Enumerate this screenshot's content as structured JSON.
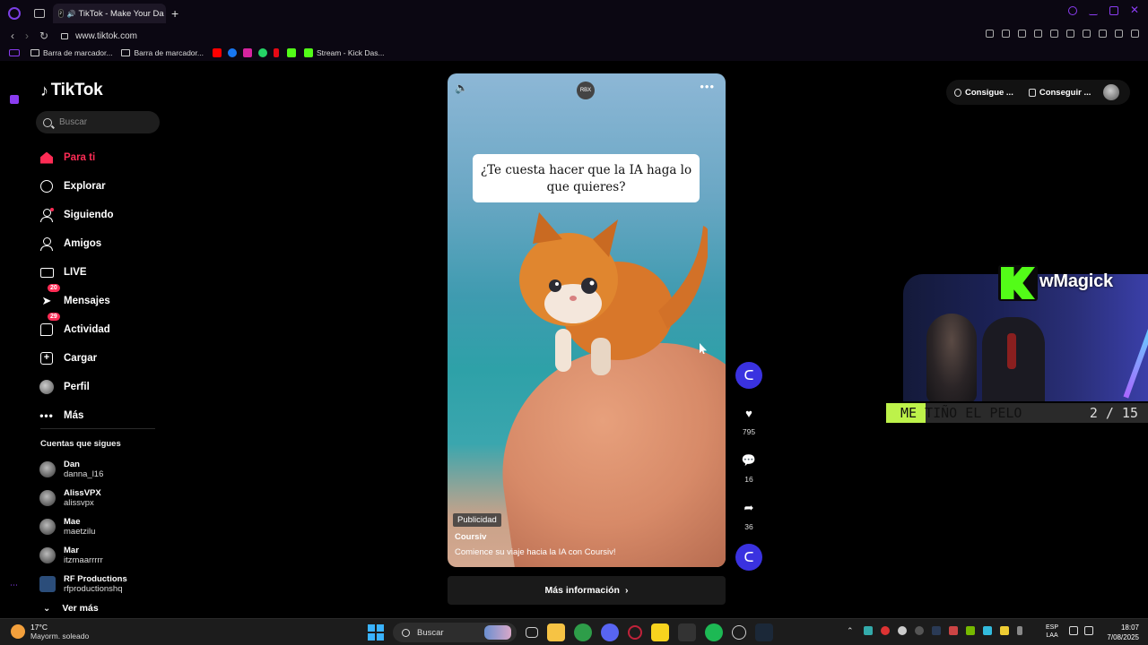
{
  "browser": {
    "tab_title": "TikTok - Make Your Da",
    "url": "www.tiktok.com",
    "new_tab_label": "+",
    "bookmarks": [
      {
        "label": "Barra de marcador..."
      },
      {
        "label": "Barra de marcador..."
      },
      {
        "label": "Stream - Kick Das..."
      }
    ]
  },
  "tiktok": {
    "logo_text": "TikTok",
    "search_placeholder": "Buscar",
    "nav": [
      {
        "label": "Para ti"
      },
      {
        "label": "Explorar"
      },
      {
        "label": "Siguiendo"
      },
      {
        "label": "Amigos"
      },
      {
        "label": "LIVE"
      },
      {
        "label": "Mensajes",
        "badge": "20"
      },
      {
        "label": "Actividad",
        "badge": "29"
      },
      {
        "label": "Cargar"
      },
      {
        "label": "Perfil"
      },
      {
        "label": "Más"
      }
    ],
    "following_title": "Cuentas que sigues",
    "following": [
      {
        "name": "Dan",
        "handle": "danna_l16"
      },
      {
        "name": "AlissVPX",
        "handle": "alissvpx"
      },
      {
        "name": "Mae",
        "handle": "maetzilu"
      },
      {
        "name": "Mar",
        "handle": "itzmaarrrrr"
      },
      {
        "name": "RF Productions",
        "handle": "rfproductionshq"
      }
    ],
    "see_more": "Ver más"
  },
  "video": {
    "rbx_label": "RBX",
    "caption": "¿Te cuesta hacer que la IA haga lo que quieres?",
    "ad_label": "Publicidad",
    "author": "Coursiv",
    "description": "Comience su viaje hacia la IA con Coursiv!",
    "cta": "Más información",
    "likes": "795",
    "comments": "16",
    "shares": "36"
  },
  "header": {
    "btn1": "Consigue ...",
    "btn2": "Conseguir ..."
  },
  "stream_overlay": {
    "channel": "wMagick",
    "ticker": "ME TIÑO EL PELO",
    "ticker_progress": 0.15,
    "page": "2 / 15"
  },
  "taskbar": {
    "temp": "17°C",
    "condition": "Mayorm. soleado",
    "search": "Buscar",
    "lang_1": "ESP",
    "lang_2": "LAA",
    "time": "18:07",
    "date": "7/08/2025"
  },
  "colors": {
    "accent": "#fe2c55",
    "kick_green": "#53fc18",
    "coursiv_blue": "#3a32e0"
  }
}
